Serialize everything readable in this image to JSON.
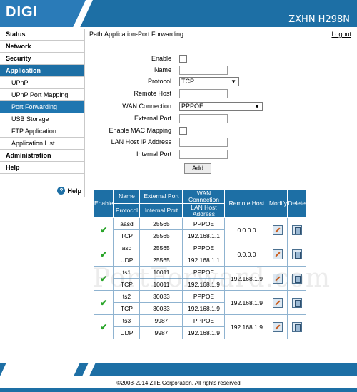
{
  "header": {
    "brand": "DIGI",
    "model": "ZXHN H298N"
  },
  "sidebar": {
    "items": [
      {
        "label": "Status",
        "level": "top"
      },
      {
        "label": "Network",
        "level": "top"
      },
      {
        "label": "Security",
        "level": "top"
      },
      {
        "label": "Application",
        "level": "top",
        "active": true
      },
      {
        "label": "UPnP",
        "level": "sub"
      },
      {
        "label": "UPnP Port Mapping",
        "level": "sub"
      },
      {
        "label": "Port Forwarding",
        "level": "sub",
        "active": true
      },
      {
        "label": "USB Storage",
        "level": "sub"
      },
      {
        "label": "FTP Application",
        "level": "sub"
      },
      {
        "label": "Application List",
        "level": "sub"
      },
      {
        "label": "Administration",
        "level": "top"
      },
      {
        "label": "Help",
        "level": "top"
      }
    ],
    "help_label": "Help"
  },
  "pathbar": {
    "path": "Path:Application-Port Forwarding",
    "logout": "Logout"
  },
  "form": {
    "enable_label": "Enable",
    "name_label": "Name",
    "protocol_label": "Protocol",
    "protocol_value": "TCP",
    "remote_host_label": "Remote Host",
    "wan_connection_label": "WAN Connection",
    "wan_connection_value": "PPPOE",
    "external_port_label": "External Port",
    "enable_mac_label": "Enable MAC Mapping",
    "lan_host_ip_label": "LAN Host IP Address",
    "internal_port_label": "Internal Port",
    "add_button": "Add"
  },
  "table": {
    "headers": {
      "enable": "Enable",
      "name": "Name",
      "protocol": "Protocol",
      "external_port": "External Port",
      "internal_port": "Internal Port",
      "wan_connection": "WAN Connection",
      "lan_host_address": "LAN Host Address",
      "remote_host": "Remote Host",
      "modify": "Modify",
      "delete": "Delete"
    },
    "rows": [
      {
        "name": "aasd",
        "protocol": "TCP",
        "external_port": "25565",
        "internal_port": "25565",
        "wan": "PPPOE",
        "lan_host": "192.168.1.1",
        "remote_host": "0.0.0.0",
        "enabled": true
      },
      {
        "name": "asd",
        "protocol": "UDP",
        "external_port": "25565",
        "internal_port": "25565",
        "wan": "PPPOE",
        "lan_host": "192.168.1.1",
        "remote_host": "0.0.0.0",
        "enabled": true
      },
      {
        "name": "ts1",
        "protocol": "TCP",
        "external_port": "10011",
        "internal_port": "10011",
        "wan": "PPPOE",
        "lan_host": "192.168.1.9",
        "remote_host": "192.168.1.9",
        "enabled": true
      },
      {
        "name": "ts2",
        "protocol": "TCP",
        "external_port": "30033",
        "internal_port": "30033",
        "wan": "PPPOE",
        "lan_host": "192.168.1.9",
        "remote_host": "192.168.1.9",
        "enabled": true
      },
      {
        "name": "ts3",
        "protocol": "UDP",
        "external_port": "9987",
        "internal_port": "9987",
        "wan": "PPPOE",
        "lan_host": "192.168.1.9",
        "remote_host": "192.168.1.9",
        "enabled": true
      }
    ]
  },
  "watermark": "PortForward.com",
  "footer": {
    "copyright": "©2008-2014 ZTE Corporation. All rights reserved"
  },
  "colors": {
    "primary_blue": "#1d6fa5",
    "check_green": "#2aa52a"
  }
}
